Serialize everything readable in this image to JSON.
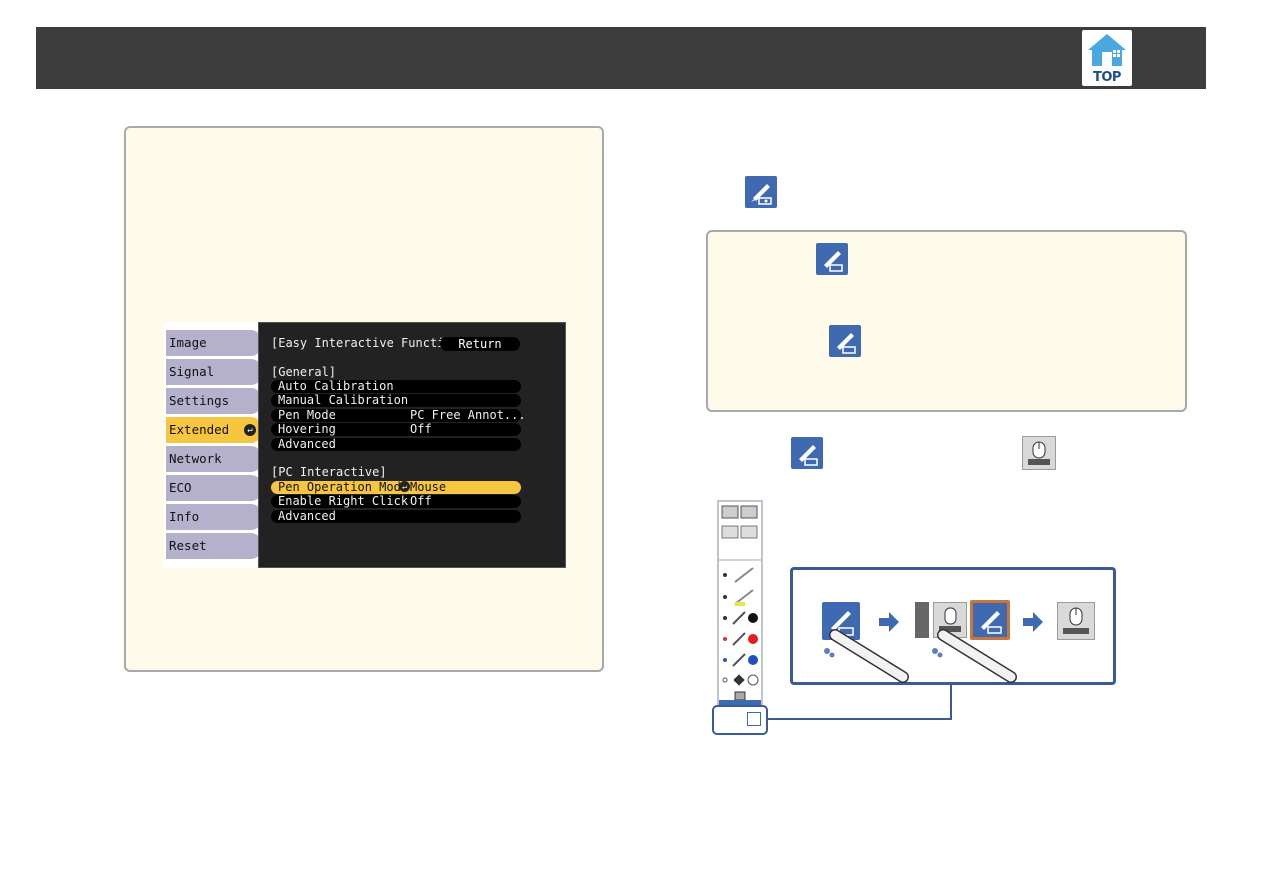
{
  "header": {
    "top_label": "TOP"
  },
  "menu": {
    "left_items": [
      {
        "label": "Image"
      },
      {
        "label": "Signal"
      },
      {
        "label": "Settings"
      },
      {
        "label": "Extended"
      },
      {
        "label": "Network"
      },
      {
        "label": "ECO"
      },
      {
        "label": "Info"
      },
      {
        "label": "Reset"
      }
    ],
    "title": "[Easy Interactive Function]",
    "return_label": "Return",
    "general_header": "[General]",
    "general_rows": [
      {
        "label": "Auto Calibration",
        "value": ""
      },
      {
        "label": "Manual Calibration",
        "value": ""
      },
      {
        "label": "Pen Mode",
        "value": "PC Free Annot..."
      },
      {
        "label": "Hovering",
        "value": "Off"
      },
      {
        "label": "Advanced",
        "value": ""
      }
    ],
    "pc_header": "[PC Interactive]",
    "pc_rows": [
      {
        "label": "Pen Operation Mode",
        "value": "Mouse"
      },
      {
        "label": "Enable Right Click",
        "value": "Off"
      },
      {
        "label": "Advanced",
        "value": ""
      }
    ],
    "colors": {
      "active": "#f7c640",
      "inactive": "#b5b0cc",
      "panel": "#222222"
    }
  },
  "icons": [
    "pen-mode-icon",
    "mouse-mode-icon",
    "toolbar-icon",
    "arrow-right-icon",
    "interactive-pen-icon",
    "top-house-icon"
  ]
}
